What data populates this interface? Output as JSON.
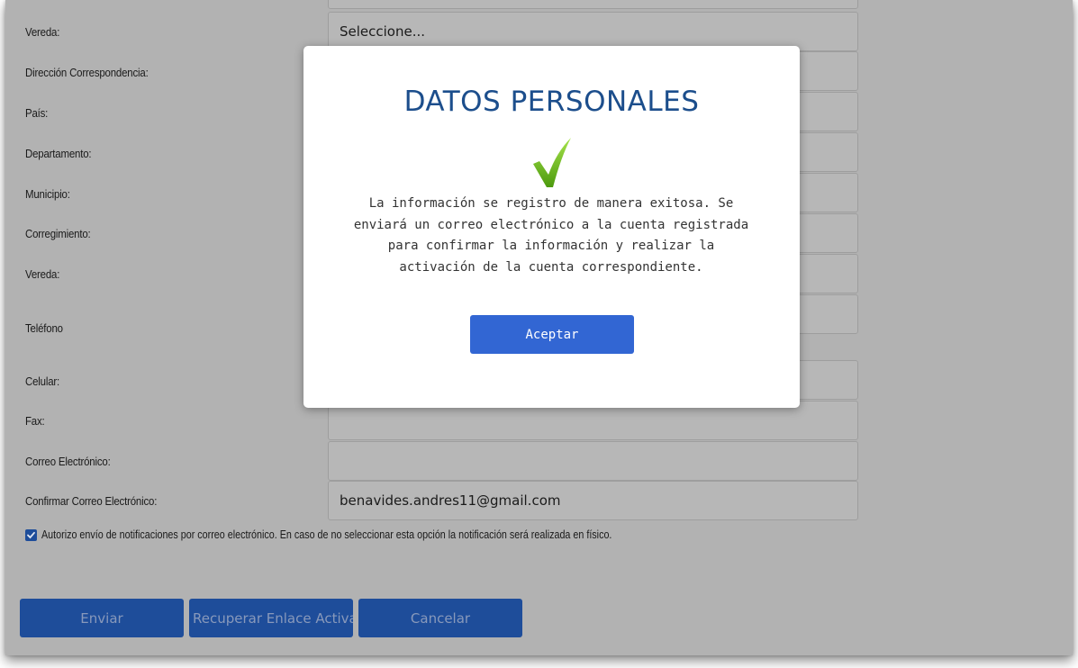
{
  "form": {
    "rows": [
      {
        "label": "Vereda:",
        "value": "Seleccione..."
      },
      {
        "label": "Dirección Correspondencia:",
        "value": ""
      },
      {
        "label": "País:",
        "value": ""
      },
      {
        "label": "Departamento:",
        "value": ""
      },
      {
        "label": "Municipio:",
        "value": ""
      },
      {
        "label": "Corregimiento:",
        "value": ""
      },
      {
        "label": "Vereda:",
        "value": ""
      },
      {
        "label": "Teléfono",
        "value": ""
      },
      {
        "label": "Celular:",
        "value": ""
      },
      {
        "label": "Fax:",
        "value": ""
      },
      {
        "label": "Correo Electrónico:",
        "value": ""
      },
      {
        "label": "Confirmar Correo Electrónico:",
        "value": "benavides.andres11@gmail.com"
      }
    ],
    "consent": {
      "checked": true,
      "text": "Autorizo envío de notificaciones por correo electrónico. En caso de no seleccionar esta opción la notificación será realizada en físico."
    },
    "buttons": {
      "send": "Enviar",
      "recover": "Recuperar Enlace Activa",
      "cancel": "Cancelar"
    }
  },
  "modal": {
    "title": "DATOS PERSONALES",
    "icon": "checkmark-icon",
    "message": "La información se registro de manera exitosa. Se enviará un correo electrónico a la cuenta registrada para confirmar la información y realizar la activación de la cuenta correspondiente.",
    "accept_label": "Aceptar"
  },
  "colors": {
    "overlay_bg": "#b2b2b2",
    "title": "#1c4e8c",
    "accept_button": "#3266d3",
    "form_button": "#1e4d9a",
    "check_green": "#7ac41b"
  }
}
